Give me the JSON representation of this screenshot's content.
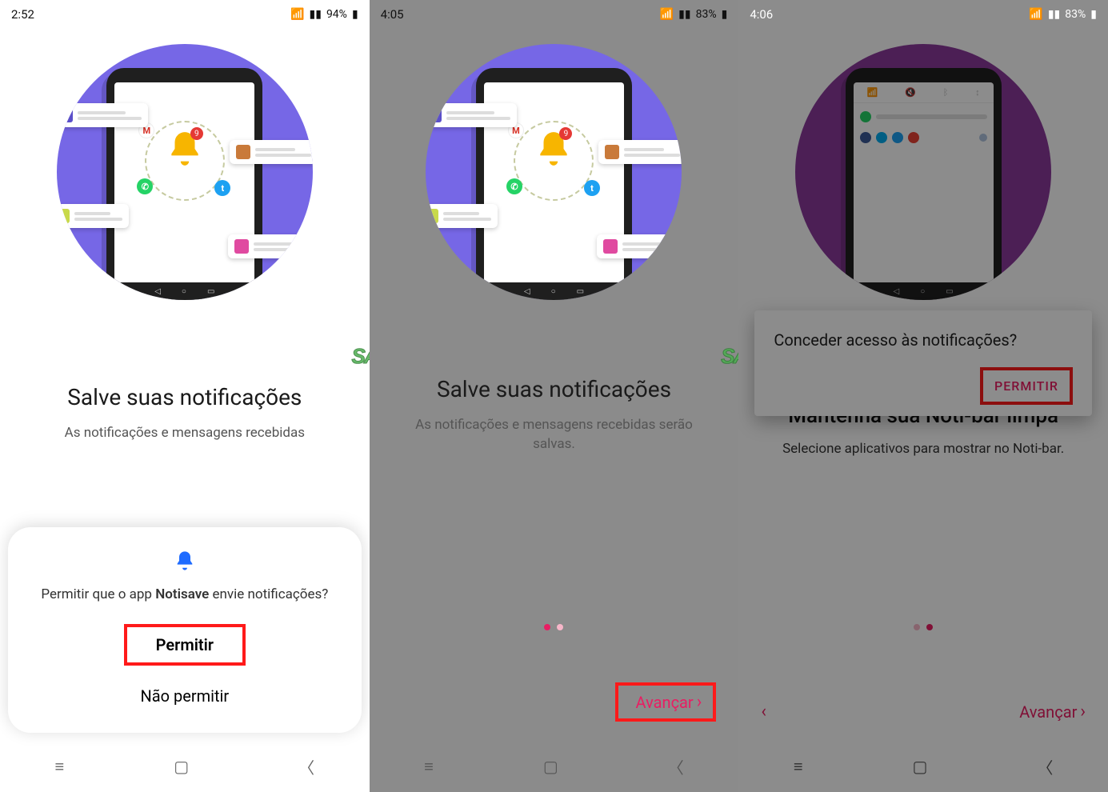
{
  "screens": [
    {
      "statusbar": {
        "time": "2:52",
        "battery": "94%"
      },
      "heading": "Salve suas notificações",
      "subtitle": "As notificações e mensagens recebidas",
      "watermark": "SA",
      "sheet": {
        "prompt_pre": "Permitir que o app ",
        "prompt_app": "Notisave",
        "prompt_post": " envie notificações?",
        "allow": "Permitir",
        "deny": "Não permitir"
      },
      "bell_badge": "9"
    },
    {
      "statusbar": {
        "time": "4:05",
        "battery": "83%"
      },
      "heading": "Salve suas notificações",
      "subtitle": "As notificações e mensagens recebidas serão salvas.",
      "watermark": "SA",
      "dots_active": 0,
      "next_label": "Avançar",
      "bell_badge": "9"
    },
    {
      "statusbar": {
        "time": "4:06",
        "battery": "83%"
      },
      "heading": "Mantenha sua Noti-bar limpa",
      "subtitle": "Selecione aplicativos para mostrar no Noti-bar.",
      "dialog": {
        "title": "Conceder acesso às notificações?",
        "allow": "PERMITIR"
      },
      "dots_active": 1,
      "next_label": "Avançar"
    }
  ]
}
